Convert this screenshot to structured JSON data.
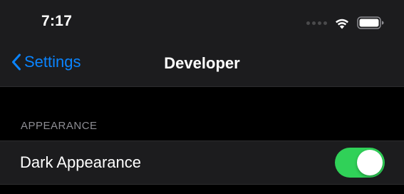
{
  "status_bar": {
    "time": "7:17",
    "icons": [
      "signal-dots-icon",
      "wifi-icon",
      "battery-icon"
    ]
  },
  "nav": {
    "back_label": "Settings",
    "title": "Developer",
    "accent_color": "#0a84ff"
  },
  "sections": [
    {
      "header": "APPEARANCE",
      "rows": [
        {
          "label": "Dark Appearance",
          "toggle_on": true,
          "toggle_color": "#30d158"
        }
      ]
    }
  ]
}
